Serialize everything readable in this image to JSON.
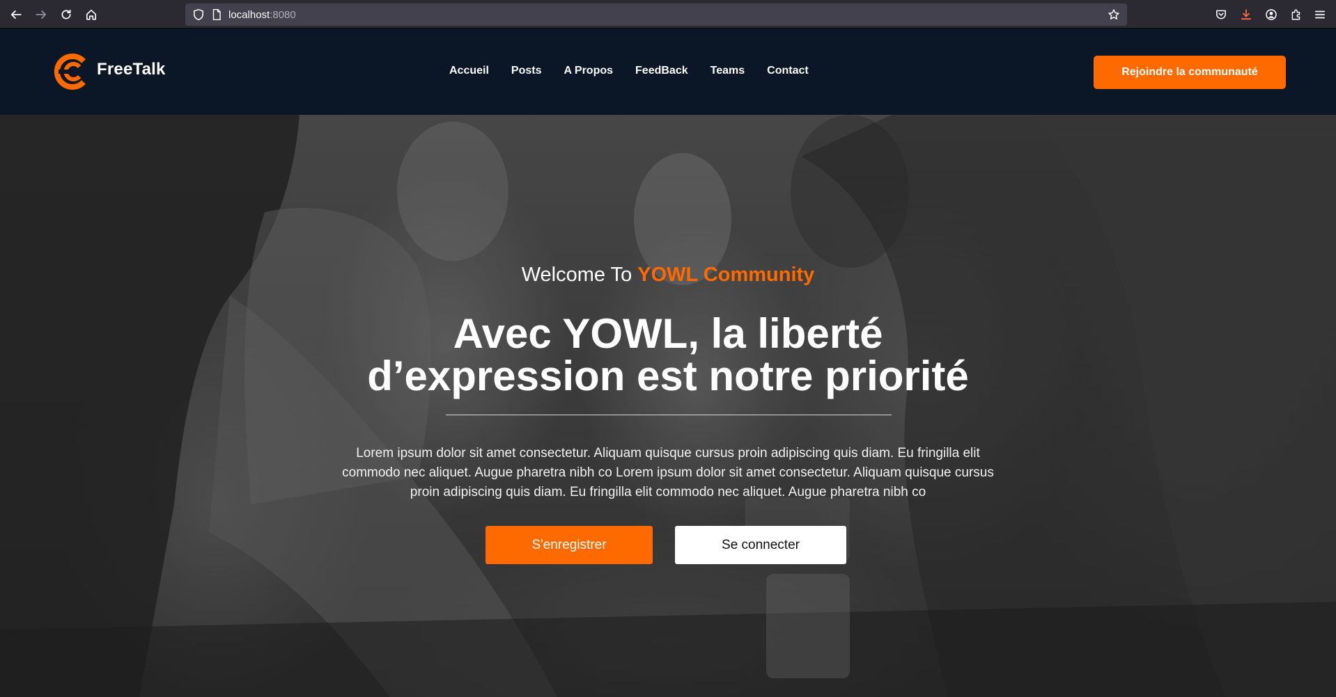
{
  "browser": {
    "url_host": "localhost",
    "url_port": ":8080"
  },
  "site": {
    "logo_text": "FreeTalk",
    "nav": [
      "Accueil",
      "Posts",
      "A Propos",
      "FeedBack",
      "Teams",
      "Contact"
    ],
    "cta_label": "Rejoindre la communauté"
  },
  "hero": {
    "welcome_prefix": "Welcome To",
    "welcome_accent": "YOWL Community",
    "headline_line1": "Avec YOWL, la liberté",
    "headline_line2": "d’expression est notre priorité",
    "lead": "Lorem ipsum dolor sit amet consectetur. Aliquam quisque cursus proin adipiscing quis diam. Eu fringilla elit commodo nec aliquet. Augue pharetra nibh co Lorem ipsum dolor sit amet consectetur. Aliquam quisque cursus proin adipiscing quis diam. Eu fringilla elit commodo nec aliquet. Augue pharetra nibh co",
    "register_label": "S'enregistrer",
    "login_label": "Se connecter"
  },
  "colors": {
    "accent": "#ff6a00",
    "nav_bg": "#0b1626"
  }
}
